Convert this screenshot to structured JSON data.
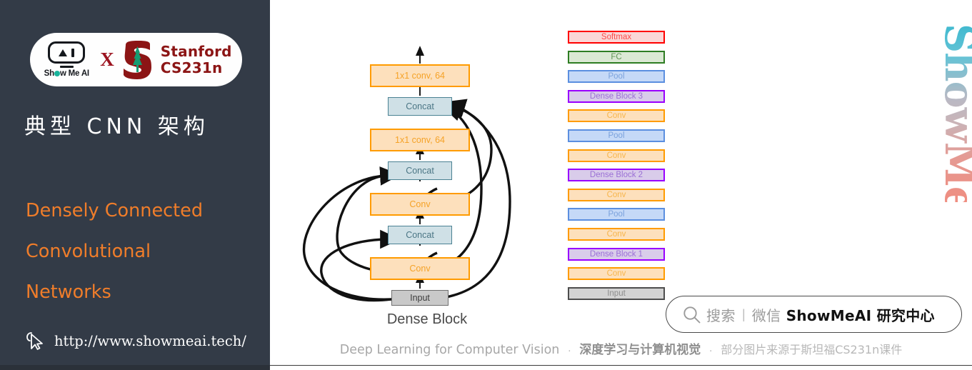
{
  "sidebar": {
    "badge": {
      "brand_name": "Show Me AI",
      "brand_name_pre": "Sh",
      "brand_name_post": "w Me AI",
      "cross_label": "X",
      "partner_line1": "Stanford",
      "partner_line2": "CS231n",
      "logo_icon": "showmeai-robot-icon",
      "partner_icon": "stanford-tree-icon"
    },
    "chinese_title": "典型 CNN 架构",
    "english_title_lines": [
      "Densely Connected",
      "Convolutional",
      "Networks"
    ],
    "website_url": "http://www.showmeai.tech/",
    "cursor_icon": "cursor-pointer-icon",
    "bg_color": "#333b47",
    "accent_color": "#f07d2a"
  },
  "diagram": {
    "caption": "Dense Block",
    "boxes": [
      {
        "label": "1x1 conv, 64",
        "type": "conv"
      },
      {
        "label": "Concat",
        "type": "concat"
      },
      {
        "label": "1x1 conv, 64",
        "type": "conv"
      },
      {
        "label": "Concat",
        "type": "concat"
      },
      {
        "label": "Conv",
        "type": "conv"
      },
      {
        "label": "Concat",
        "type": "concat"
      },
      {
        "label": "Conv",
        "type": "conv"
      },
      {
        "label": "Input",
        "type": "input"
      }
    ],
    "colors": {
      "conv_border": "#ff9b00",
      "conv_fill": "#fde0bc",
      "concat_border": "#4b8293",
      "concat_fill": "#cfe0e6",
      "input_border": "#6f6f6f",
      "input_fill": "#c9c9c9"
    }
  },
  "architecture_stack": {
    "rows": [
      {
        "label": "Softmax",
        "cls": "st-softmax",
        "border": "#ff0000"
      },
      {
        "label": "FC",
        "cls": "st-fc",
        "border": "#2e7d23"
      },
      {
        "label": "Pool",
        "cls": "st-pool",
        "border": "#5b8fe0"
      },
      {
        "label": "Dense Block 3",
        "cls": "st-dense",
        "border": "#9900ff"
      },
      {
        "label": "Conv",
        "cls": "st-conv",
        "border": "#ff9b00"
      },
      {
        "label": "Pool",
        "cls": "st-pool",
        "border": "#5b8fe0"
      },
      {
        "label": "Conv",
        "cls": "st-conv",
        "border": "#ff9b00"
      },
      {
        "label": "Dense Block 2",
        "cls": "st-dense",
        "border": "#9900ff"
      },
      {
        "label": "Conv",
        "cls": "st-conv",
        "border": "#ff9b00"
      },
      {
        "label": "Pool",
        "cls": "st-pool",
        "border": "#5b8fe0"
      },
      {
        "label": "Conv",
        "cls": "st-conv",
        "border": "#ff9b00"
      },
      {
        "label": "Dense Block 1",
        "cls": "st-dense",
        "border": "#9900ff"
      },
      {
        "label": "Conv",
        "cls": "st-conv",
        "border": "#ff9b00"
      },
      {
        "label": "Input",
        "cls": "st-input",
        "border": "#4d4d4d"
      }
    ]
  },
  "search_pill": {
    "icon": "search-icon",
    "placeholder_text": "搜索",
    "divider": "|",
    "channel_text": "微信",
    "account_name": "ShowMeAI 研究中心"
  },
  "footer": {
    "english": "Deep Learning for Computer Vision",
    "sep1": "·",
    "chinese_bold": "深度学习与计算机视觉",
    "sep2": "·",
    "chinese_note": "部分图片来源于斯坦福CS231n课件"
  },
  "watermark": {
    "text": "ShowMeAI",
    "gradient_from": "#3fb9cf",
    "gradient_to": "#ef8d80"
  }
}
